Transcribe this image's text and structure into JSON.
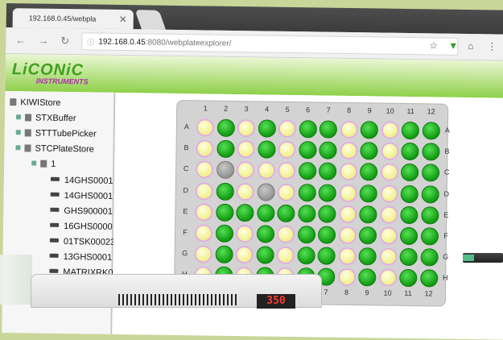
{
  "browser": {
    "tab_title": "192.168.0.45/webpla",
    "tab_close": "✕",
    "url_host": "192.168.0.45",
    "url_path": ":8080/webplateexplorer/"
  },
  "app": {
    "logo_main": "LiCONiC",
    "logo_sub": "INSTRUMENTS"
  },
  "tree": {
    "root": "KIWIStore",
    "stores": [
      "STXBuffer",
      "STTTubePicker",
      "STCPlateStore"
    ],
    "cassette": "1",
    "plates": [
      "14GHS0001",
      "14GHS0001",
      "GHS900001",
      "16GHS0000",
      "01TSK00023",
      "13GHS0001",
      "MATRIXRK0"
    ]
  },
  "plate": {
    "columns": [
      "1",
      "2",
      "3",
      "4",
      "5",
      "6",
      "7",
      "8",
      "9",
      "10",
      "11",
      "12"
    ],
    "rows": [
      "A",
      "B",
      "C",
      "D",
      "E",
      "F",
      "G",
      "H"
    ],
    "wells": [
      "ygygyggygygg",
      "ygygyggygygg",
      "yeyyyggygygg",
      "ygyeyggygygg",
      "yggggggygygg",
      "ygygyggygygg",
      "ygygyggygygg",
      "ygygyggygygg"
    ],
    "legend_colors": {
      "occupied": "#1aa61a",
      "partial": "#f3f38c",
      "empty": "#9a9a9a"
    }
  },
  "device": {
    "display_value": "350"
  }
}
